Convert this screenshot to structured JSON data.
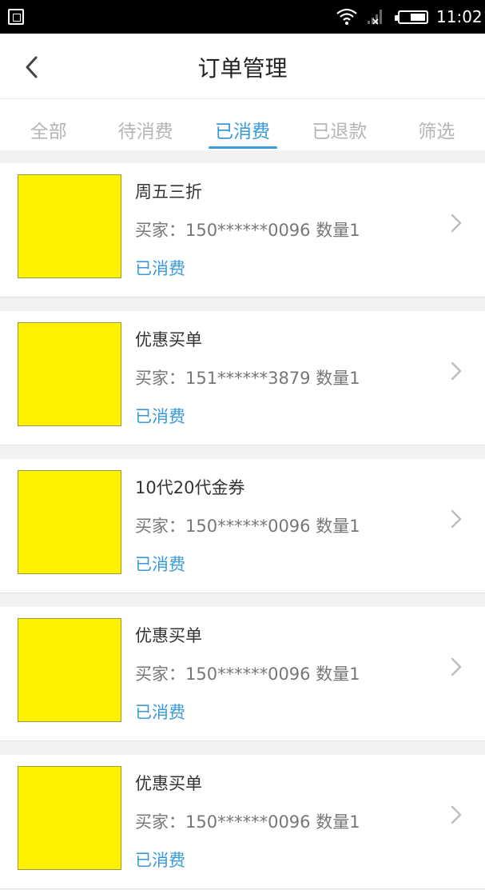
{
  "status_bar": {
    "time": "11:02",
    "battery_level": 0.55
  },
  "header": {
    "title": "订单管理"
  },
  "tabs": [
    {
      "label": "全部",
      "active": false
    },
    {
      "label": "待消费",
      "active": false
    },
    {
      "label": "已消费",
      "active": true
    },
    {
      "label": "已退款",
      "active": false
    },
    {
      "label": "筛选",
      "active": false
    }
  ],
  "orders": [
    {
      "name": "周五三折",
      "buyer": "买家：150******0096 数量1",
      "status": "已消费"
    },
    {
      "name": "优惠买单",
      "buyer": "买家：151******3879 数量1",
      "status": "已消费"
    },
    {
      "name": "10代20代金券",
      "buyer": "买家：150******0096 数量1",
      "status": "已消费"
    },
    {
      "name": "优惠买单",
      "buyer": "买家：150******0096 数量1",
      "status": "已消费"
    },
    {
      "name": "优惠买单",
      "buyer": "买家：150******0096 数量1",
      "status": "已消费"
    }
  ],
  "colors": {
    "accent": "#3a9ad9",
    "thumbnail": "#fff200"
  },
  "icons": {
    "back": "back-arrow-icon",
    "row_chevron": "chevron-right-icon"
  }
}
